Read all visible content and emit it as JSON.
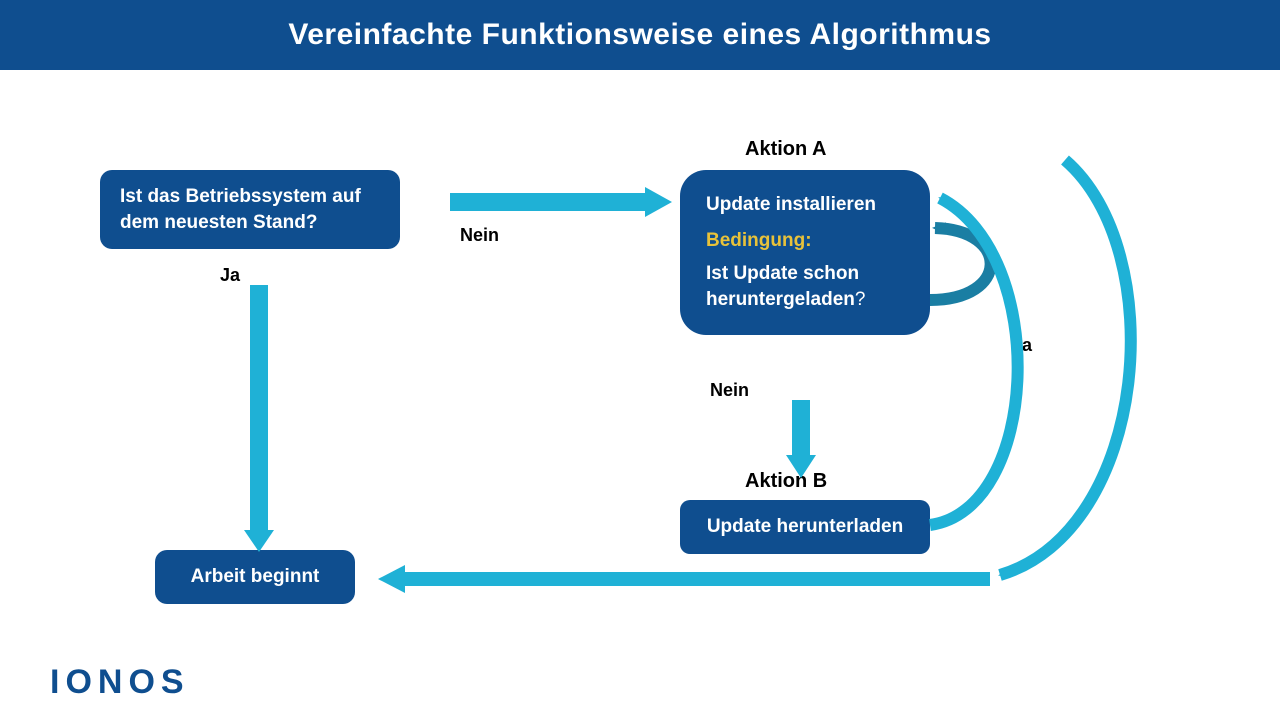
{
  "header": {
    "title": "Vereinfachte Funktionsweise eines Algorithmus"
  },
  "nodes": {
    "question": "Ist das Betriebssystem auf dem neuesten Stand?",
    "actionA_label": "Aktion A",
    "actionA_line1": "Update installieren",
    "actionA_cond_label": "Bedingung:",
    "actionA_cond_text": "Ist Update schon heruntergeladen",
    "actionB_label": "Aktion B",
    "actionB_text": "Update herunterladen",
    "start": "Arbeit beginnt"
  },
  "edges": {
    "ja1": "Ja",
    "nein1": "Nein",
    "nein2": "Nein",
    "ja2": "Ja"
  },
  "brand": {
    "logo": "IONOS"
  },
  "colors": {
    "primary": "#0f4e8f",
    "arrow": "#1fb1d6",
    "curve": "#1a7ea3",
    "accent": "#e8c23a"
  }
}
